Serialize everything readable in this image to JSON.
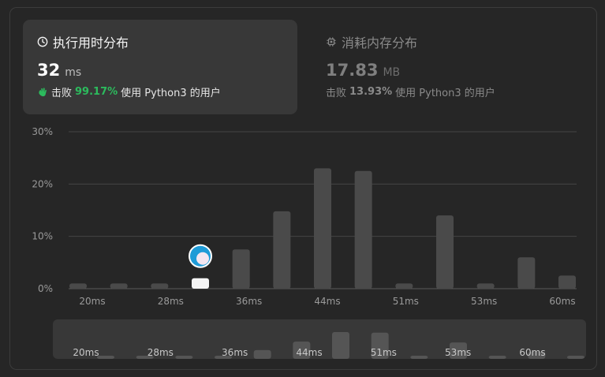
{
  "runtime_card": {
    "title": "执行用时分布",
    "value": "32",
    "unit": "ms",
    "beat_prefix": "击败",
    "beat_percent": "99.17%",
    "beat_suffix": "使用 Python3 的用户",
    "icon": "clock-icon"
  },
  "memory_card": {
    "title": "消耗内存分布",
    "value": "17.83",
    "unit": "MB",
    "beat_prefix": "击败",
    "beat_percent": "13.93%",
    "beat_suffix": "使用 Python3 的用户",
    "icon": "chip-icon"
  },
  "colors": {
    "accent_green": "#2cbb5d",
    "bar": "#4a4a4a",
    "highlight_bar": "#f5f5f5",
    "avatar_blue": "#1e9bd7"
  },
  "chart_data": {
    "type": "bar",
    "ylim": [
      0,
      30
    ],
    "y_ticks": [
      "0%",
      "10%",
      "20%",
      "30%"
    ],
    "x_tick_labels": [
      "20ms",
      "28ms",
      "36ms",
      "44ms",
      "51ms",
      "53ms",
      "60ms"
    ],
    "values": [
      1,
      1,
      1,
      2,
      7.5,
      14.8,
      23,
      22.5,
      1,
      14,
      1,
      6,
      2.5
    ],
    "highlight_index": 3,
    "grid": true
  },
  "mini_chart": {
    "x_tick_labels": [
      "20ms",
      "28ms",
      "36ms",
      "44ms",
      "51ms",
      "53ms",
      "60ms"
    ]
  }
}
